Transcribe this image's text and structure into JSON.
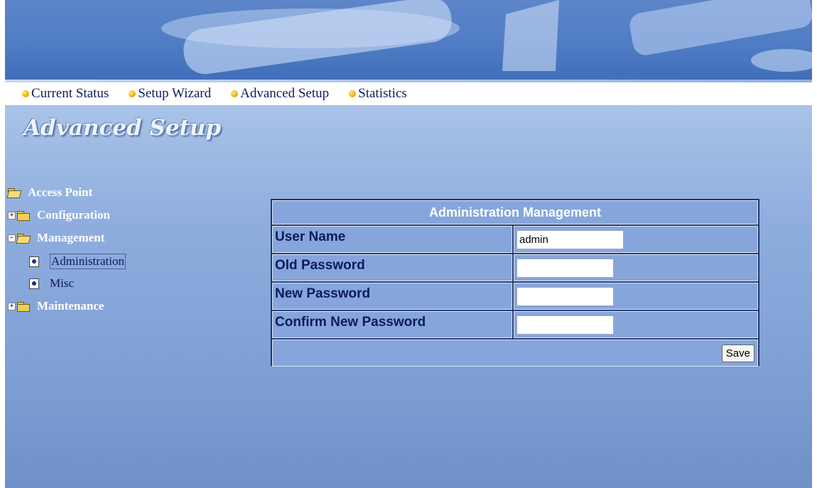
{
  "nav": {
    "items": [
      "Current Status",
      "Setup Wizard",
      "Advanced Setup",
      "Statistics"
    ]
  },
  "page_title": "Advanced Setup",
  "tree": {
    "root": "Access Point",
    "configuration": "Configuration",
    "management": "Management",
    "administration": "Administration",
    "misc": "Misc",
    "maintenance": "Maintenance",
    "expand_symbol": "+",
    "collapse_symbol": "−"
  },
  "panel": {
    "title": "Administration Management",
    "fields": [
      {
        "label": "User Name",
        "value": "admin"
      },
      {
        "label": "Old Password",
        "value": ""
      },
      {
        "label": "New Password",
        "value": ""
      },
      {
        "label": "Confirm New Password",
        "value": ""
      }
    ],
    "save_label": "Save"
  },
  "colors": {
    "banner": "#4f7cc4",
    "nav_text": "#0f1f5a",
    "panel_cell": "#86a6db",
    "bullet": "#f2b200"
  }
}
